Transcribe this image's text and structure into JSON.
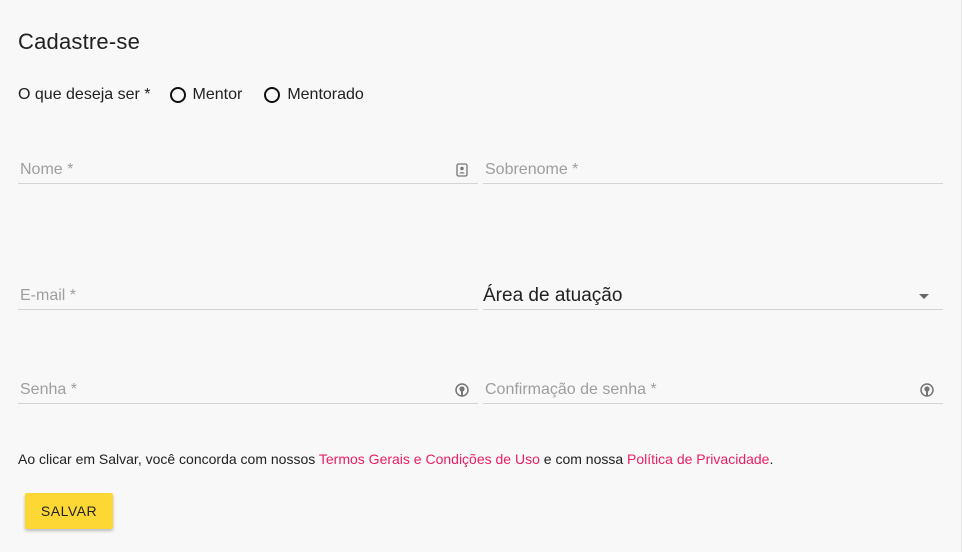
{
  "form": {
    "title": "Cadastre-se",
    "role_question": "O que deseja ser *",
    "role_options": [
      {
        "label": "Mentor",
        "selected": false
      },
      {
        "label": "Mentorado",
        "selected": false
      }
    ],
    "fields": {
      "nome": {
        "placeholder": "Nome *",
        "value": "",
        "icon": "contact-card-icon"
      },
      "sobrenome": {
        "placeholder": "Sobrenome *",
        "value": ""
      },
      "email": {
        "placeholder": "E-mail *",
        "value": ""
      },
      "area": {
        "value": "Área de atuação",
        "icon": "dropdown-arrow-icon"
      },
      "senha": {
        "placeholder": "Senha *",
        "value": "",
        "icon": "password-visibility-icon"
      },
      "confirmacao": {
        "placeholder": "Confirmação de senha *",
        "value": "",
        "icon": "password-visibility-icon"
      }
    },
    "terms": {
      "prefix": "Ao clicar em Salvar, você concorda com nossos ",
      "terms_link": "Termos Gerais e Condições de Uso",
      "middle": " e com nossa ",
      "privacy_link": "Política de Privacidade",
      "suffix": "."
    },
    "save_label": "SALVAR"
  },
  "colors": {
    "background": "#f8f8f8",
    "link": "#e91e63",
    "button": "#fdd835",
    "underline": "#d4d4d4"
  }
}
